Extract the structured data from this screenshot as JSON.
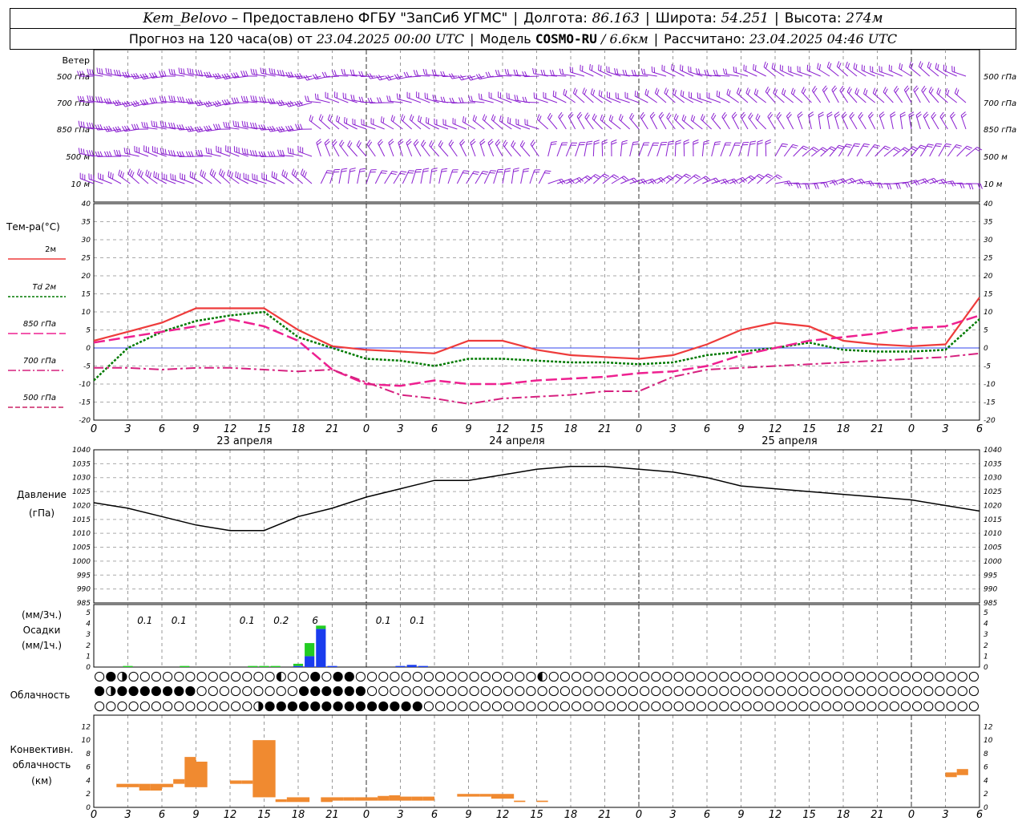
{
  "header": {
    "station": "Kem_Belovo",
    "provider": "– Предоставлено ФГБУ \"ЗапСиб УГМС\"",
    "lon_label": "Долгота:",
    "lon_value": "86.163",
    "lat_label": "Широта:",
    "lat_value": "54.251",
    "alt_label": "Высота:",
    "alt_value": "274м",
    "forecast_prefix": "Прогноз на 120 часа(ов) от",
    "forecast_start": "23.04.2025 00:00 UTC",
    "model_label": "Модель",
    "model_name": "COSMO-RU",
    "model_res": "/ 6.6км",
    "calc_label": "Рассчитано:",
    "calc_time": "23.04.2025 04:46 UTC"
  },
  "labels": {
    "wind_title": "Ветер",
    "wind_levels": [
      "500 гПа",
      "700 гПа",
      "850 гПа",
      "500 м",
      "10 м"
    ],
    "temp_title": "Тем-ра(°C)",
    "temp_legend": [
      "2м",
      "Td 2м",
      "850 гПа",
      "700 гПа",
      "500 гПа"
    ],
    "pressure_title": "Давление",
    "pressure_unit": "(гПа)",
    "precip_title_1": "(мм/3ч.)",
    "precip_title_2": "Осадки",
    "precip_title_3": "(мм/1ч.)",
    "cloud_title": "Облачность",
    "conv_title_1": "Конвективн.",
    "conv_title_2": "облачность",
    "conv_title_3": "(км)"
  },
  "colors": {
    "t2m": "#ee3b3b",
    "td2m": "#007a00",
    "t850": "#ee2090",
    "t700": "#d6207f",
    "t500": "#cc2266",
    "wind": "#8a1fd0",
    "pressure": "#000000",
    "precip_green": "#22cc22",
    "precip_blue": "#1a3cee",
    "conv": "#f08a30"
  },
  "chart_data": [
    {
      "type": "line",
      "title": "Тем-ра(°C)",
      "x_unit": "hours since 23.04.2025 00:00 UTC",
      "x_tick_labels": [
        "0",
        "3",
        "6",
        "9",
        "12",
        "15",
        "18",
        "21",
        "0",
        "3",
        "6",
        "9",
        "12",
        "15",
        "18",
        "21",
        "0",
        "3",
        "6",
        "9",
        "12",
        "15",
        "18",
        "21",
        "0",
        "3",
        "6"
      ],
      "day_labels": [
        "23 апреля",
        "24 апреля",
        "25 апреля"
      ],
      "ylim": [
        -20,
        40
      ],
      "y_ticks": [
        -20,
        -15,
        -10,
        -5,
        0,
        5,
        10,
        15,
        20,
        25,
        30,
        35,
        40
      ],
      "x": [
        0,
        3,
        6,
        9,
        12,
        15,
        18,
        21,
        24,
        27,
        30,
        33,
        36,
        39,
        42,
        45,
        48,
        51,
        54,
        57,
        60,
        63,
        66,
        69,
        72,
        75,
        78
      ],
      "series": [
        {
          "name": "2м",
          "values": [
            2,
            4.5,
            7,
            11,
            11,
            11,
            5,
            0.5,
            -0.5,
            -1,
            -1.5,
            2,
            2,
            -0.5,
            -2,
            -2.5,
            -3,
            -2,
            1,
            5,
            7,
            6,
            2,
            1,
            0.5,
            1,
            14
          ]
        },
        {
          "name": "Td 2м",
          "values": [
            -9,
            0,
            4.5,
            7.5,
            9,
            10,
            3,
            0,
            -3,
            -3.5,
            -5,
            -3,
            -3,
            -3.5,
            -4,
            -4,
            -4.5,
            -4,
            -2,
            -1,
            0,
            1.5,
            -0.5,
            -1,
            -1,
            -0.5,
            8
          ]
        },
        {
          "name": "850 гПа",
          "values": [
            1.5,
            3,
            4.5,
            6,
            8,
            6,
            2,
            -6,
            -10,
            -10.5,
            -9,
            -10,
            -10,
            -9,
            -8.5,
            -8,
            -7,
            -6.5,
            -5,
            -2,
            0,
            2,
            3,
            4,
            5.5,
            6,
            9
          ]
        },
        {
          "name": "700 гПа",
          "values": [
            -5.5,
            -5.5,
            -6,
            -5.5,
            -5.5,
            -6,
            -6.5,
            -6,
            -9.5,
            -13,
            -14,
            -15.5,
            -14,
            -13.5,
            -13,
            -12,
            -12,
            -8,
            -6,
            -5.5,
            -5,
            -4.5,
            -4,
            -3.5,
            -3,
            -2.5,
            -1.5
          ]
        }
      ]
    },
    {
      "type": "line",
      "title": "Давление (гПа)",
      "ylim": [
        985,
        1040
      ],
      "y_ticks": [
        985,
        990,
        995,
        1000,
        1005,
        1010,
        1015,
        1020,
        1025,
        1030,
        1035,
        1040
      ],
      "x": [
        0,
        3,
        6,
        9,
        12,
        15,
        18,
        21,
        24,
        27,
        30,
        33,
        36,
        39,
        42,
        45,
        48,
        51,
        54,
        57,
        60,
        63,
        66,
        69,
        72,
        75,
        78
      ],
      "series": [
        {
          "name": "Давление",
          "values": [
            1021,
            1019,
            1016,
            1013,
            1011,
            1011,
            1016,
            1019,
            1023,
            1026,
            1029,
            1029,
            1031,
            1033,
            1034,
            1034,
            1033,
            1032,
            1030,
            1027,
            1026,
            1025,
            1024,
            1023,
            1022,
            1020,
            1018
          ]
        }
      ]
    },
    {
      "type": "bar",
      "title": "Осадки",
      "ylim": [
        0,
        5
      ],
      "y_ticks": [
        0,
        1,
        2,
        3,
        4,
        5
      ],
      "labels_3h": [
        {
          "x": 4.5,
          "text": "0.1"
        },
        {
          "x": 7.5,
          "text": "0.1"
        },
        {
          "x": 13.5,
          "text": "0.1"
        },
        {
          "x": 16.5,
          "text": "0.2"
        },
        {
          "x": 19.5,
          "text": "6"
        },
        {
          "x": 25.5,
          "text": "0.1"
        },
        {
          "x": 28.5,
          "text": "0.1"
        }
      ],
      "bars_1h": [
        {
          "x": 3,
          "blue": 0,
          "green": 0.1
        },
        {
          "x": 8,
          "blue": 0,
          "green": 0.1
        },
        {
          "x": 14,
          "blue": 0,
          "green": 0.1
        },
        {
          "x": 15,
          "blue": 0,
          "green": 0.1
        },
        {
          "x": 16,
          "blue": 0,
          "green": 0.1
        },
        {
          "x": 18,
          "blue": 0.1,
          "green": 0.2
        },
        {
          "x": 19,
          "blue": 1.0,
          "green": 1.2
        },
        {
          "x": 20,
          "blue": 3.5,
          "green": 0.3
        },
        {
          "x": 21,
          "blue": 0.1,
          "green": 0
        },
        {
          "x": 27,
          "blue": 0.1,
          "green": 0
        },
        {
          "x": 28,
          "blue": 0.2,
          "green": 0
        },
        {
          "x": 29,
          "blue": 0.1,
          "green": 0
        }
      ]
    },
    {
      "type": "bar",
      "title": "Конвективн. облачность (км)",
      "ylim": [
        0,
        13
      ],
      "y_ticks": [
        0,
        2,
        4,
        6,
        8,
        10,
        12
      ],
      "bars": [
        {
          "x": 2.5,
          "base": 3,
          "top": 3.5
        },
        {
          "x": 3.5,
          "base": 3,
          "top": 3.5
        },
        {
          "x": 4.5,
          "base": 2.5,
          "top": 3.5
        },
        {
          "x": 5.5,
          "base": 2.5,
          "top": 3.5
        },
        {
          "x": 6.5,
          "base": 3,
          "top": 3.5
        },
        {
          "x": 7.5,
          "base": 3.5,
          "top": 4.2
        },
        {
          "x": 8.5,
          "base": 3,
          "top": 7.5
        },
        {
          "x": 9.5,
          "base": 3,
          "top": 6.8
        },
        {
          "x": 12.5,
          "base": 3.5,
          "top": 4
        },
        {
          "x": 13.5,
          "base": 3.5,
          "top": 4
        },
        {
          "x": 14.5,
          "base": 1.5,
          "top": 10
        },
        {
          "x": 15.5,
          "base": 1.5,
          "top": 10
        },
        {
          "x": 16.5,
          "base": 0.8,
          "top": 1.2
        },
        {
          "x": 17.5,
          "base": 0.8,
          "top": 1.5
        },
        {
          "x": 18.5,
          "base": 0.8,
          "top": 1.5
        },
        {
          "x": 20.5,
          "base": 0.8,
          "top": 1.5
        },
        {
          "x": 21.5,
          "base": 1,
          "top": 1.5
        },
        {
          "x": 22.5,
          "base": 1,
          "top": 1.5
        },
        {
          "x": 23.5,
          "base": 1,
          "top": 1.5
        },
        {
          "x": 24.5,
          "base": 1,
          "top": 1.5
        },
        {
          "x": 25.5,
          "base": 1,
          "top": 1.7
        },
        {
          "x": 26.5,
          "base": 1,
          "top": 1.8
        },
        {
          "x": 27.5,
          "base": 1,
          "top": 1.6
        },
        {
          "x": 28.5,
          "base": 1,
          "top": 1.6
        },
        {
          "x": 29.5,
          "base": 1,
          "top": 1.6
        },
        {
          "x": 32.5,
          "base": 1.6,
          "top": 2
        },
        {
          "x": 33.5,
          "base": 1.6,
          "top": 2
        },
        {
          "x": 34.5,
          "base": 1.6,
          "top": 2
        },
        {
          "x": 35.5,
          "base": 1.3,
          "top": 2
        },
        {
          "x": 36.5,
          "base": 1.3,
          "top": 2
        },
        {
          "x": 37.5,
          "base": 0.8,
          "top": 1
        },
        {
          "x": 39.5,
          "base": 0.8,
          "top": 1
        },
        {
          "x": 75.5,
          "base": 4.5,
          "top": 5.2
        },
        {
          "x": 76.5,
          "base": 4.8,
          "top": 5.7
        }
      ]
    }
  ]
}
